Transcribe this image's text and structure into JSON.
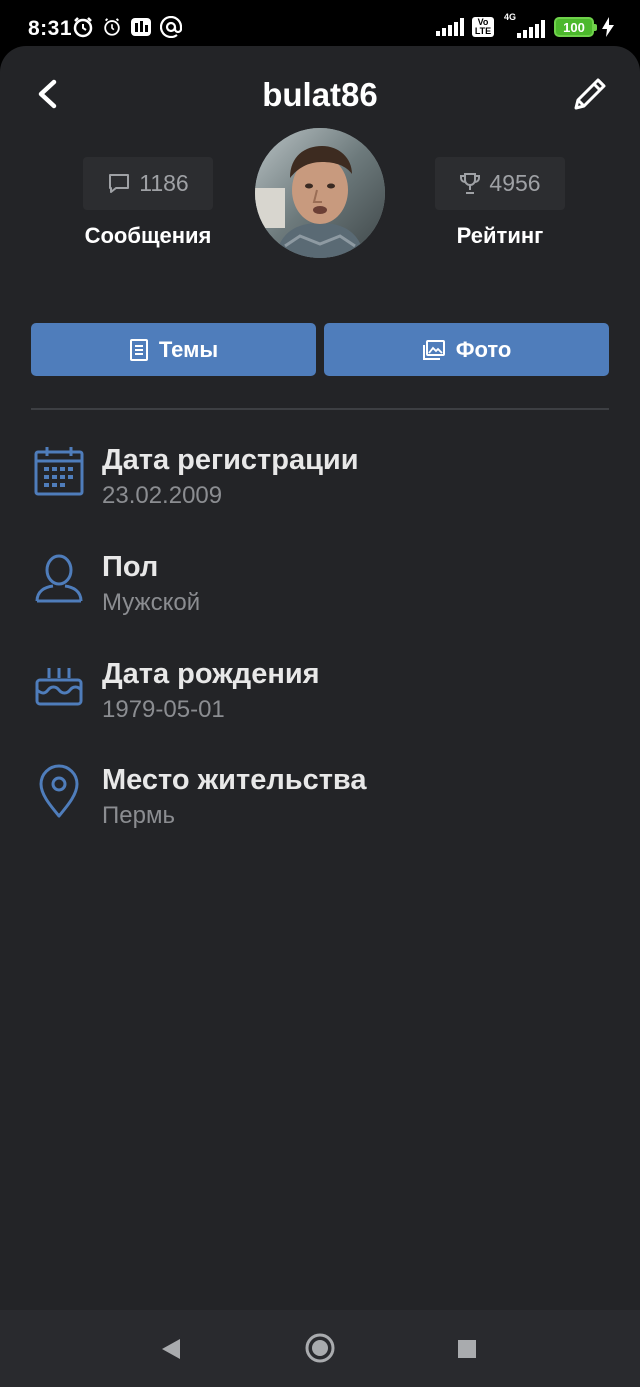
{
  "status_bar": {
    "time": "8:31",
    "volte": "Vo LTE",
    "network": "4G",
    "battery": "100"
  },
  "header": {
    "title": "bulat86"
  },
  "stats": {
    "messages": {
      "value": "1186",
      "label": "Сообщения"
    },
    "rating": {
      "value": "4956",
      "label": "Рейтинг"
    }
  },
  "buttons": {
    "topics": "Темы",
    "photo": "Фото"
  },
  "info": [
    {
      "title": "Дата регистрации",
      "value": "23.02.2009",
      "icon": "calendar-icon"
    },
    {
      "title": "Пол",
      "value": "Мужской",
      "icon": "person-icon"
    },
    {
      "title": "Дата рождения",
      "value": "1979-05-01",
      "icon": "cake-icon"
    },
    {
      "title": "Место жительства",
      "value": "Пермь",
      "icon": "location-pin-icon"
    }
  ],
  "colors": {
    "background": "#232427",
    "accent": "#4f7dbb",
    "icon": "#4f7dbb"
  }
}
